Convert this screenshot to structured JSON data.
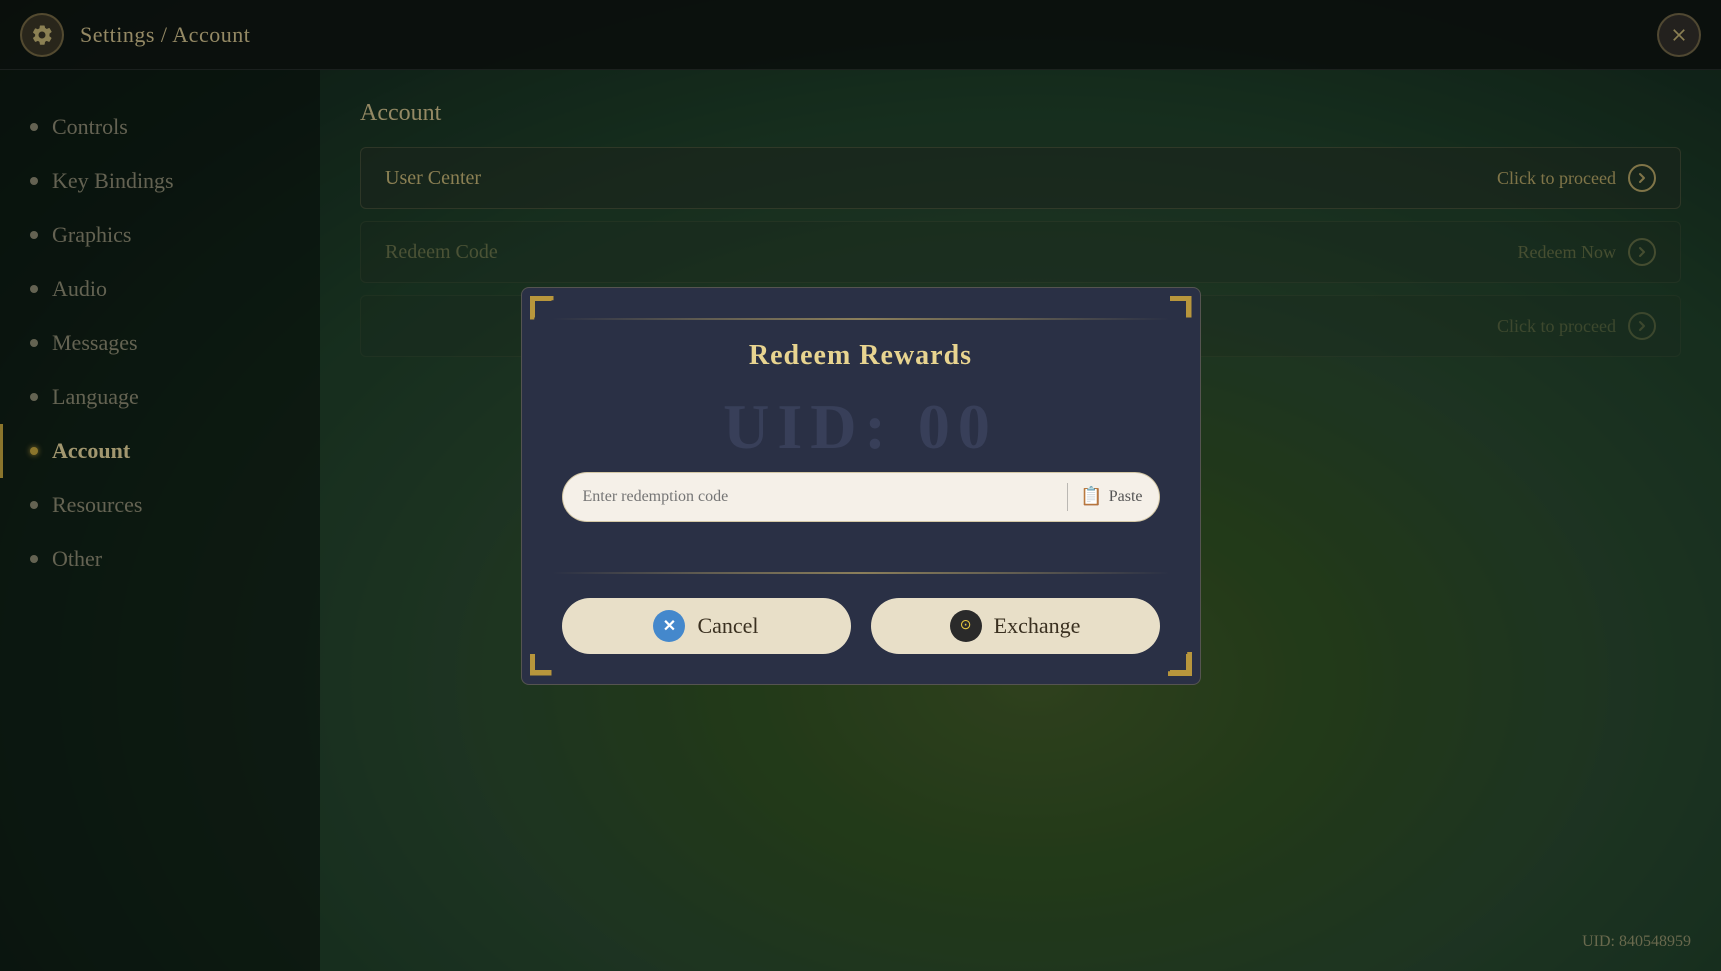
{
  "topbar": {
    "breadcrumb": "Settings / Account",
    "close_label": "×"
  },
  "sidebar": {
    "items": [
      {
        "id": "controls",
        "label": "Controls",
        "active": false
      },
      {
        "id": "key-bindings",
        "label": "Key Bindings",
        "active": false
      },
      {
        "id": "graphics",
        "label": "Graphics",
        "active": false
      },
      {
        "id": "audio",
        "label": "Audio",
        "active": false
      },
      {
        "id": "messages",
        "label": "Messages",
        "active": false
      },
      {
        "id": "language",
        "label": "Language",
        "active": false
      },
      {
        "id": "account",
        "label": "Account",
        "active": true
      },
      {
        "id": "resources",
        "label": "Resources",
        "active": false
      },
      {
        "id": "other",
        "label": "Other",
        "active": false
      }
    ]
  },
  "content": {
    "title": "Account",
    "rows": [
      {
        "label": "User Center",
        "right_text": "Click to proceed"
      },
      {
        "label": "Redeem Code",
        "right_text": "Redeem Now"
      },
      {
        "label": "",
        "right_text": "Click to proceed"
      }
    ]
  },
  "modal": {
    "title": "Redeem Rewards",
    "watermark": "UID: 00",
    "input": {
      "placeholder": "Enter redemption code",
      "paste_label": "Paste"
    },
    "cancel_label": "Cancel",
    "exchange_label": "Exchange"
  },
  "uid": {
    "label": "UID: 840548959"
  }
}
